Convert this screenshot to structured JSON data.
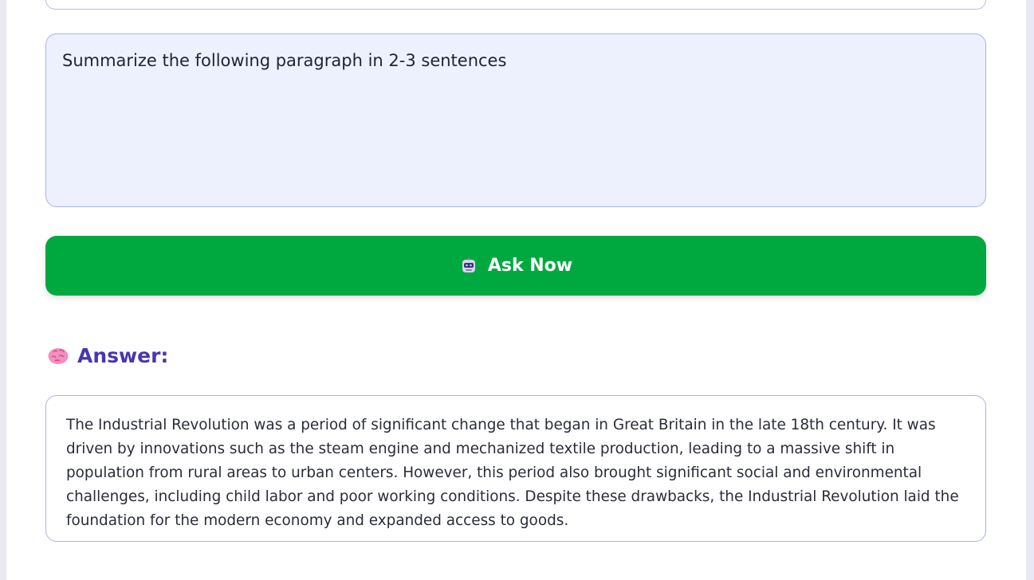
{
  "prompt": {
    "value": "Summarize the following paragraph in 2-3 sentences"
  },
  "ask_button": {
    "label": "Ask Now",
    "icon": "robot-icon",
    "color": "#00a940"
  },
  "answer": {
    "heading": "Answer:",
    "icon": "brain-icon",
    "text": " The Industrial Revolution was a period of significant change that began in Great Britain in the late 18th century. It was driven by innovations such as the steam engine and mechanized textile production, leading to a massive shift in population from rural areas to urban centers. However, this period also brought significant social and environmental challenges, including child labor and poor working conditions. Despite these drawbacks, the Industrial Revolution laid the foundation for the modern economy and expanded access to goods."
  },
  "colors": {
    "accent": "#4a35b0",
    "input_bg": "#edf1fd",
    "border": "#aab4e0"
  }
}
